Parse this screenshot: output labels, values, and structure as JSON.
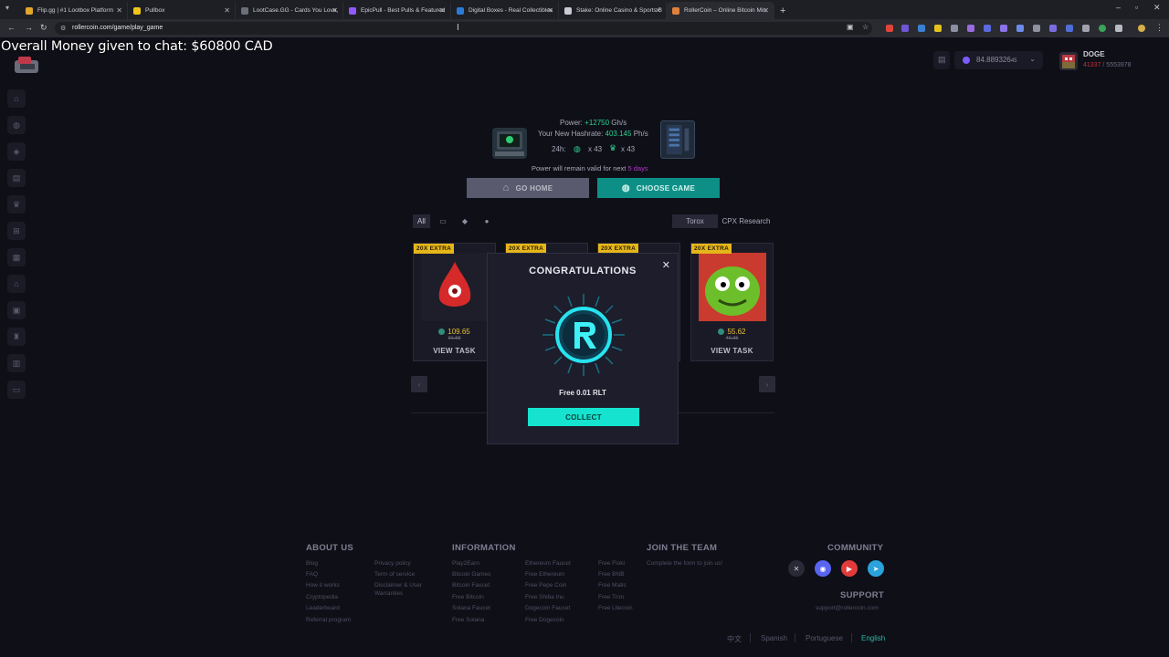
{
  "browser": {
    "tabs": [
      {
        "title": "Flip.gg | #1 Lootbox Platform",
        "color": "#e3a62a",
        "active": false
      },
      {
        "title": "Pullbox",
        "color": "#f0c419",
        "active": false
      },
      {
        "title": "LootCase.GG - Cards You Love,",
        "color": "#6d6f78",
        "active": false
      },
      {
        "title": "EpicPull - Best Pulls & Featured",
        "color": "#9059ff",
        "active": true
      },
      {
        "title": "Digital Boxes - Real Collectibles",
        "color": "#2b7bd6",
        "active": false
      },
      {
        "title": "Stake: Online Casino & Sports B",
        "color": "#c9cbd2",
        "active": false
      },
      {
        "title": "RollerCoin – Online Bitcoin Min",
        "color": "#e0813b",
        "active": false
      }
    ],
    "url": "rollercoin.com/game/play_game",
    "nav_icons": [
      "back-icon",
      "forward-icon",
      "reload-icon"
    ],
    "window_controls": [
      "minimize-icon",
      "maximize-icon",
      "close-icon"
    ]
  },
  "overlay": {
    "text": "Overall Money given to chat: $60800 CAD"
  },
  "header": {
    "balance": "84.889326",
    "balance_suffix": "45",
    "username": "DOGE",
    "stat_red": "41337",
    "stat_rest": "/ 5553978"
  },
  "sidebar": {
    "icons": [
      "home-icon",
      "gamepad-icon",
      "rank-icon",
      "storage-icon",
      "crown-icon",
      "cart-icon",
      "inventory-icon",
      "bank-icon",
      "calendar-icon",
      "trophy-icon",
      "factory-icon",
      "wallet-icon"
    ]
  },
  "power": {
    "power_label": "Power:",
    "power_value": "+12750",
    "power_unit": "Gh/s",
    "hashrate_label": "Your New Hashrate:",
    "hashrate_value": "403.145",
    "hashrate_unit": "Ph/s",
    "period": "24h:",
    "games_count": "x 43",
    "trophy_count": "x 43",
    "valid_prefix": "Power will remain valid for next",
    "valid_days": "5 days"
  },
  "buttons": {
    "go_home": "GO HOME",
    "choose_game": "CHOOSE GAME"
  },
  "filters": {
    "all": "All",
    "torox": "Torox",
    "cpx": "CPX Research"
  },
  "cards": [
    {
      "badge": "20X EXTRA",
      "price": "109.65",
      "old": "91.88",
      "cta": "VIEW TASK"
    },
    {
      "badge": "20X EXTRA",
      "price": "",
      "old": "",
      "cta": ""
    },
    {
      "badge": "20X EXTRA",
      "price": "",
      "old": "",
      "cta": ""
    },
    {
      "badge": "20X EXTRA",
      "price": "55.62",
      "old": "46.35",
      "cta": "VIEW TASK"
    }
  ],
  "modal": {
    "title": "CONGRATULATIONS",
    "reward": "Free 0.01 RLT",
    "collect": "COLLECT"
  },
  "footer": {
    "about": {
      "heading": "ABOUT US",
      "col1": [
        "Blog",
        "FAQ",
        "How it works",
        "Cryptopedia",
        "Leaderboard",
        "Referral program"
      ],
      "col2": [
        "Privacy policy",
        "Term of service",
        "Disclaimer & User",
        "Warranties"
      ]
    },
    "information": {
      "heading": "INFORMATION",
      "col1": [
        "Play2Earn",
        "Bitcoin Games",
        "Bitcoin Faucet",
        "Free Bitcoin",
        "Solana Faucet",
        "Free Solana"
      ],
      "col2": [
        "Ethereum Faucet",
        "Free Ethereum",
        "Free Pepe Coin",
        "Free Shiba Inu",
        "Dogecoin Faucet",
        "Free Dogecoin"
      ],
      "col3": [
        "Free Floki",
        "Free BNB",
        "Free Matic",
        "Free Tron",
        "Free Litecoin"
      ]
    },
    "join": {
      "heading": "JOIN THE TEAM",
      "text": "Complete the form to join us!"
    },
    "community": {
      "heading": "COMMUNITY",
      "icons": [
        "x-icon",
        "discord-icon",
        "youtube-icon",
        "telegram-icon"
      ]
    },
    "support": {
      "heading": "SUPPORT",
      "email": "support@rollercoin.com"
    },
    "languages": [
      "中文",
      "Spanish",
      "Portuguese",
      "English"
    ]
  }
}
